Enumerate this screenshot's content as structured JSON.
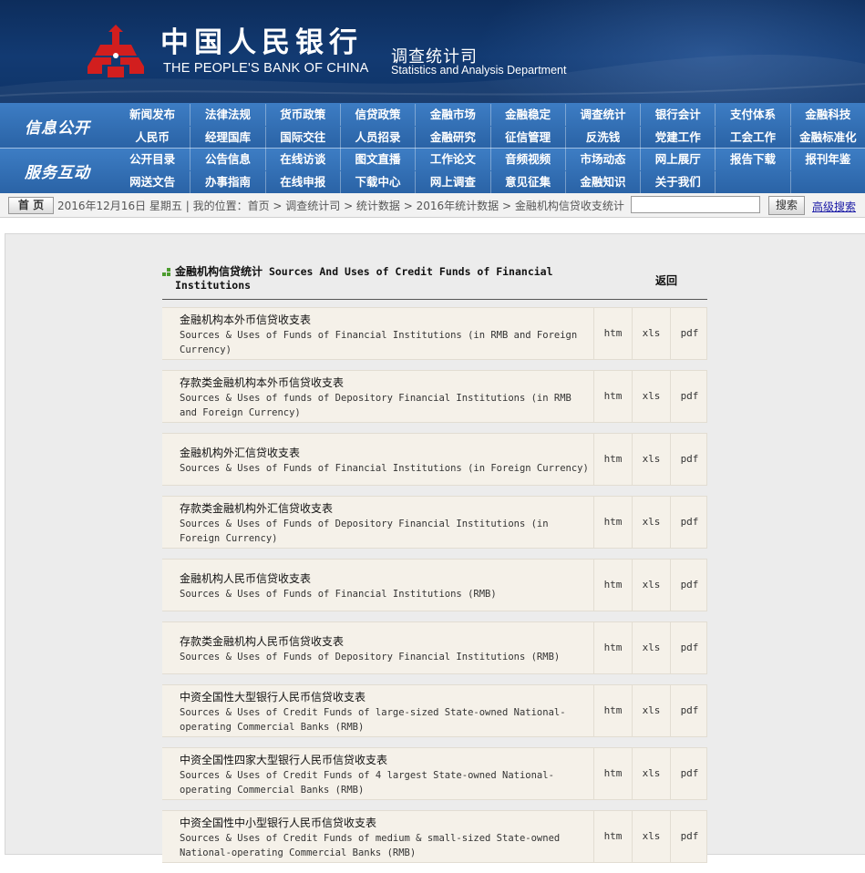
{
  "header": {
    "bank_cn": "中国人民银行",
    "bank_en": "THE PEOPLE'S BANK OF CHINA",
    "dept_cn": "调查统计司",
    "dept_en": "Statistics and Analysis Department",
    "brand_color": "#123a72",
    "logo_color": "#d21e1e"
  },
  "nav": {
    "bands": [
      "信息公开",
      "服务互动"
    ],
    "row1": [
      "新闻发布",
      "法律法规",
      "货币政策",
      "信贷政策",
      "金融市场",
      "金融稳定",
      "调查统计",
      "银行会计",
      "支付体系",
      "金融科技"
    ],
    "row2": [
      "人民币",
      "经理国库",
      "国际交往",
      "人员招录",
      "金融研究",
      "征信管理",
      "反洗钱",
      "党建工作",
      "工会工作",
      "金融标准化"
    ],
    "row3": [
      "公开目录",
      "公告信息",
      "在线访谈",
      "图文直播",
      "工作论文",
      "音频视频",
      "市场动态",
      "网上展厅",
      "报告下载",
      "报刊年鉴"
    ],
    "row4": [
      "网送文告",
      "办事指南",
      "在线申报",
      "下载中心",
      "网上调查",
      "意见征集",
      "金融知识",
      "关于我们"
    ]
  },
  "breadcrumb": {
    "home": "首 页",
    "text": "2016年12月16日 星期五 | 我的位置：首页 > 调查统计司 > 统计数据 > 2016年统计数据 > 金融机构信贷收支统计",
    "search_button": "搜索",
    "advanced": "高级搜索"
  },
  "content": {
    "title_cn": "金融机构信贷统计",
    "title_en": "Sources And Uses of Credit Funds of Financial Institutions",
    "back": "返回",
    "items": [
      {
        "cn": "金融机构本外币信贷收支表",
        "en": "Sources & Uses of Funds of Financial Institutions (in RMB and Foreign Currency)",
        "f": [
          "htm",
          "xls",
          "pdf"
        ]
      },
      {
        "cn": "存款类金融机构本外币信贷收支表",
        "en": "Sources & Uses of funds of Depository Financial Institutions (in RMB and Foreign Currency)",
        "f": [
          "htm",
          "xls",
          "pdf"
        ]
      },
      {
        "cn": "金融机构外汇信贷收支表",
        "en": "Sources & Uses of Funds of Financial Institutions (in Foreign Currency)",
        "f": [
          "htm",
          "xls",
          "pdf"
        ]
      },
      {
        "cn": "存款类金融机构外汇信贷收支表",
        "en": "Sources & Uses of Funds of Depository Financial Institutions (in Foreign Currency)",
        "f": [
          "htm",
          "xls",
          "pdf"
        ]
      },
      {
        "cn": "金融机构人民币信贷收支表",
        "en": "Sources & Uses of Funds of Financial Institutions (RMB)",
        "f": [
          "htm",
          "xls",
          "pdf"
        ]
      },
      {
        "cn": "存款类金融机构人民币信贷收支表",
        "en": "Sources & Uses of Funds of Depository Financial Institutions (RMB)",
        "f": [
          "htm",
          "xls",
          "pdf"
        ]
      },
      {
        "cn": "中资全国性大型银行人民币信贷收支表",
        "en": "Sources & Uses of Credit Funds of large-sized State-owned National-operating Commercial Banks (RMB)",
        "f": [
          "htm",
          "xls",
          "pdf"
        ]
      },
      {
        "cn": "中资全国性四家大型银行人民币信贷收支表",
        "en": "Sources & Uses of Credit Funds of 4 largest State-owned National-operating Commercial Banks (RMB)",
        "f": [
          "htm",
          "xls",
          "pdf"
        ]
      },
      {
        "cn": "中资全国性中小型银行人民币信贷收支表",
        "en": "Sources & Uses of Credit Funds of medium & small-sized State-owned National-operating Commercial Banks (RMB)",
        "f": [
          "htm",
          "xls",
          "pdf"
        ]
      }
    ]
  }
}
